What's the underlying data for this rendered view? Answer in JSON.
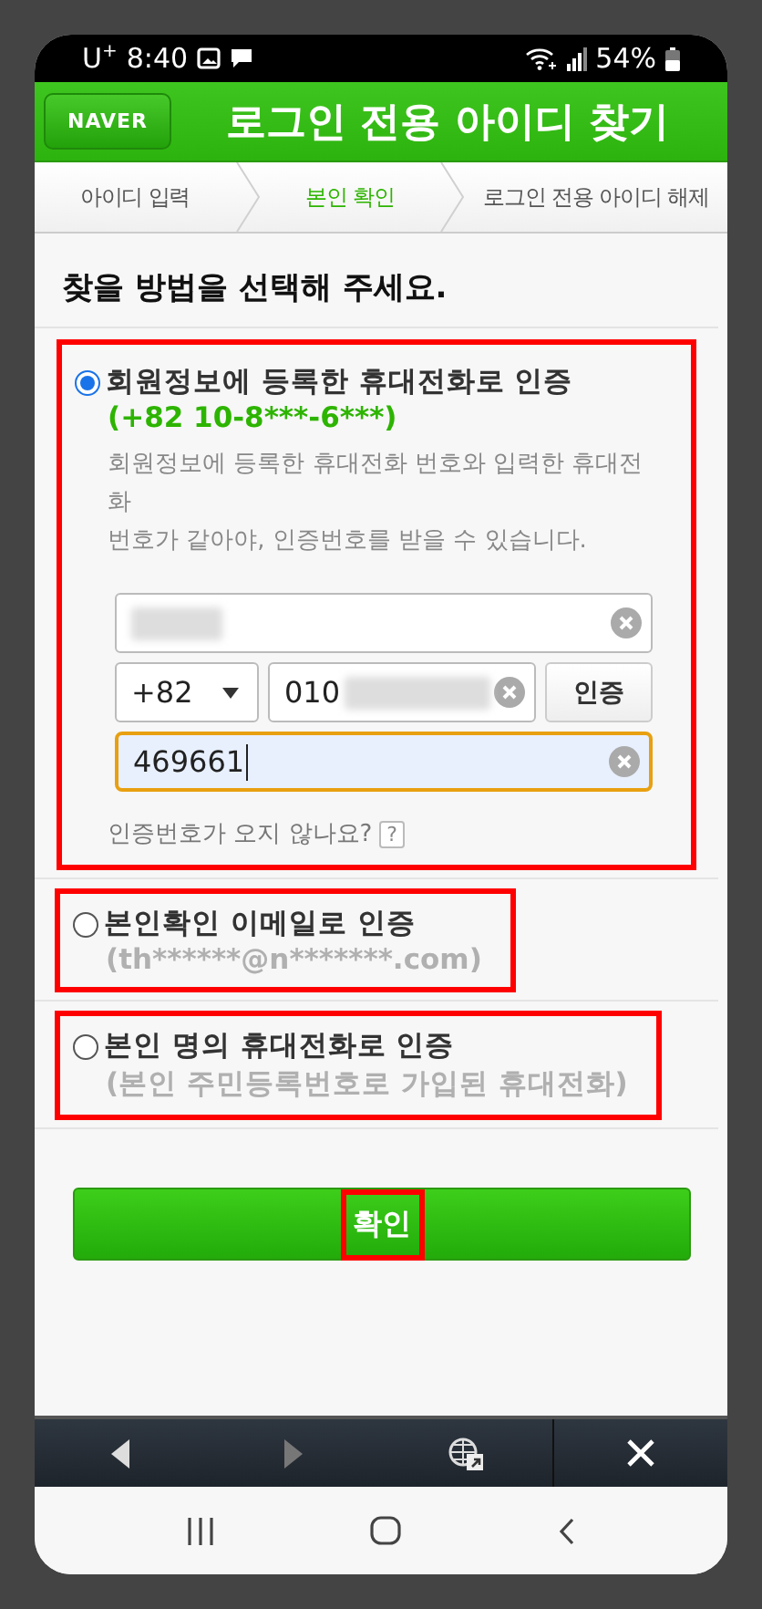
{
  "status_bar": {
    "carrier": "U$^{+}$",
    "time": "8:40",
    "battery": "54%"
  },
  "header": {
    "logo": "NAVER",
    "title": "로그인 전용 아이디 찾기"
  },
  "steps": [
    {
      "label": "아이디 입력",
      "selected": false
    },
    {
      "label": "본인 확인",
      "selected": true
    },
    {
      "label": "로그인 전용 아이디 해제",
      "selected": false
    }
  ],
  "heading": "찾을 방법을 선택해 주세요.",
  "options": [
    {
      "kind": "phone-form",
      "title": "회원정보에 등록한 휴대전화로 인증",
      "detail": "(+82 10-8***-6***)",
      "selected": true,
      "highlighted": true,
      "description": [
        "회원정보에 등록한 휴대전화 번호와 입력한 휴대전화",
        "번호가 같아야, 인증번호를 받을 수 있습니다."
      ],
      "name_redacted": true,
      "country_code": "+82",
      "phone_prefix": "010",
      "phone_redacted": true,
      "verify_button": "인증",
      "code_value": "469661",
      "help_text": "인증번호가 오지 않나요?",
      "help_icon": "?"
    },
    {
      "kind": "simple",
      "title": "본인확인 이메일로 인증",
      "detail": "(th******@n*******.com)",
      "selected": false,
      "highlighted": true
    },
    {
      "kind": "simple",
      "title": "본인 명의 휴대전화로 인증",
      "detail": "(본인 주민등록번호로 가입된 휴대전화)",
      "selected": false,
      "highlighted": true
    }
  ],
  "confirm_button": {
    "label": "확인",
    "highlighted": true
  }
}
